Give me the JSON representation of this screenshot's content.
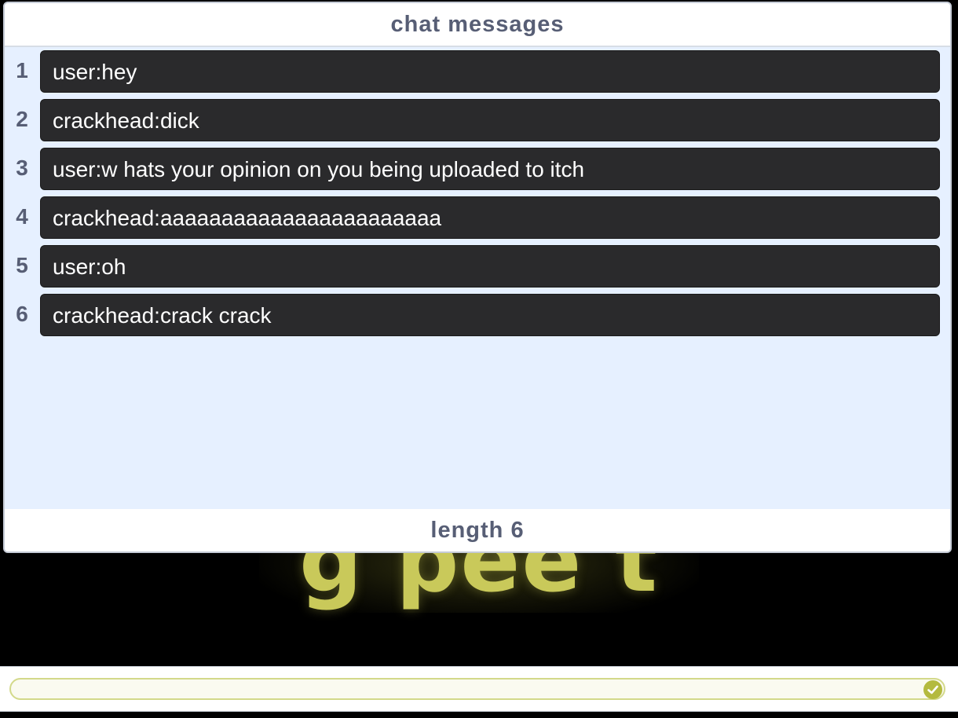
{
  "stage": {
    "background_text": "g pee t"
  },
  "chat_list": {
    "title": "chat messages",
    "items": [
      {
        "index": "1",
        "text": "user:hey"
      },
      {
        "index": "2",
        "text": "crackhead:dick"
      },
      {
        "index": "3",
        "text": "user:w hats your opinion on you being uploaded to itch"
      },
      {
        "index": "4",
        "text": "crackhead:aaaaaaaaaaaaaaaaaaaaaaa"
      },
      {
        "index": "5",
        "text": "user:oh"
      },
      {
        "index": "6",
        "text": "crackhead:crack crack"
      }
    ],
    "length_label": "length 6"
  },
  "answer": {
    "value": "",
    "submit_icon": "check-circle-icon"
  },
  "colors": {
    "panel_bg": "#e6f0ff",
    "label_text": "#575e75",
    "cell_bg": "#2a2a2c",
    "accent": "#b4ba3f"
  }
}
